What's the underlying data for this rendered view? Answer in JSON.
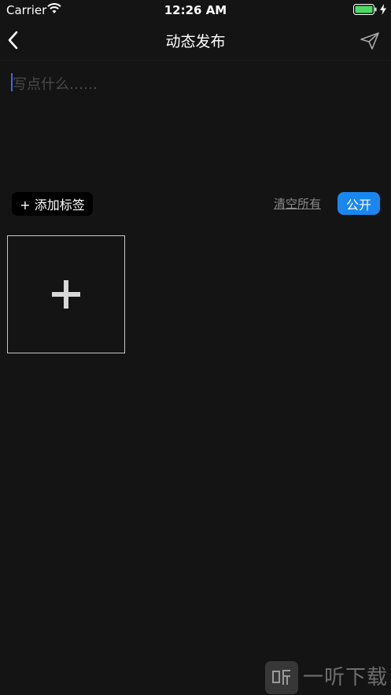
{
  "status_bar": {
    "carrier": "Carrier",
    "time": "12:26 AM"
  },
  "nav": {
    "title": "动态发布"
  },
  "composer": {
    "placeholder": "写点什么……"
  },
  "toolbar": {
    "add_tag_label": "+ 添加标签",
    "clear_all_label": "清空所有",
    "visibility_label": "公开"
  },
  "watermark": {
    "text": "一听下载"
  },
  "colors": {
    "background": "#141414",
    "accent": "#1a86f0",
    "placeholder": "#4a4a4a",
    "caret": "#3a6ce0"
  }
}
